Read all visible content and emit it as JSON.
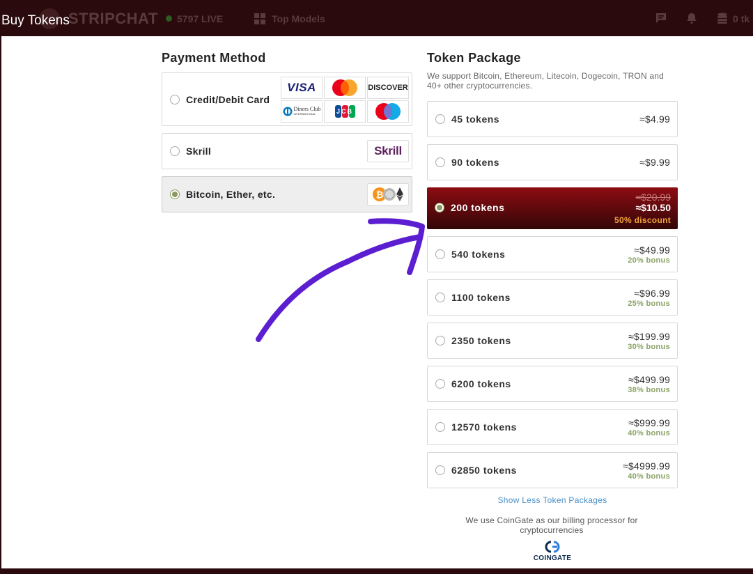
{
  "header": {
    "modal_title": "Buy Tokens",
    "site_name": "STRIPCHAT",
    "live_count": "5797 LIVE",
    "top_models": "Top Models",
    "token_balance": "0 tk"
  },
  "payment": {
    "title": "Payment Method",
    "options": [
      {
        "label": "Credit/Debit Card",
        "selected": false
      },
      {
        "label": "Skrill",
        "selected": false
      },
      {
        "label": "Bitcoin, Ether, etc.",
        "selected": true
      }
    ],
    "card_brands": {
      "visa": "VISA",
      "discover": "DISCOVER",
      "jcb": "JCB",
      "diners": "Diners Club",
      "diners_sub": "INTERNATIONAL"
    },
    "skrill_logo": "Skrill"
  },
  "tokens": {
    "title": "Token Package",
    "subtitle": "We support Bitcoin, Ethereum, Litecoin, Dogecoin, TRON and 40+ other cryptocurrencies.",
    "packages": [
      {
        "label": "45 tokens",
        "price": "≈$4.99"
      },
      {
        "label": "90 tokens",
        "price": "≈$9.99"
      },
      {
        "label": "200 tokens",
        "old_price": "≈$20.99",
        "price": "≈$10.50",
        "discount": "50% discount",
        "selected": true
      },
      {
        "label": "540 tokens",
        "price": "≈$49.99",
        "bonus": "20% bonus"
      },
      {
        "label": "1100 tokens",
        "price": "≈$96.99",
        "bonus": "25% bonus"
      },
      {
        "label": "2350 tokens",
        "price": "≈$199.99",
        "bonus": "30% bonus"
      },
      {
        "label": "6200 tokens",
        "price": "≈$499.99",
        "bonus": "38% bonus"
      },
      {
        "label": "12570 tokens",
        "price": "≈$999.99",
        "bonus": "40% bonus"
      },
      {
        "label": "62850 tokens",
        "price": "≈$4999.99",
        "bonus": "40% bonus"
      }
    ],
    "show_less": "Show Less Token Packages",
    "coingate_text": "We use CoinGate as our billing processor for cryptocurrencies",
    "coingate_logo": "COINGATE"
  },
  "colors": {
    "highlight_top": "#8d0d13",
    "highlight_bottom": "#330607",
    "bonus_green": "#8aa365",
    "discount_orange": "#f2a33a",
    "annotation_arrow": "#5b1fd1"
  }
}
